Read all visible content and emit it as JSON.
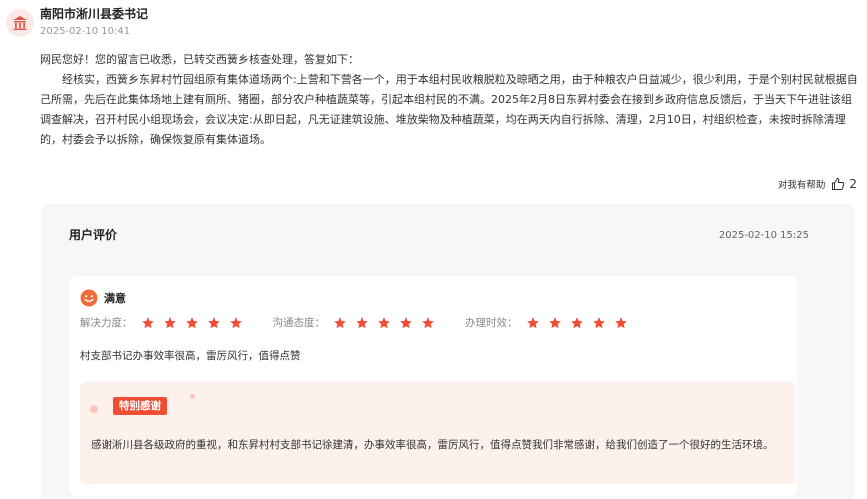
{
  "header": {
    "org_name": "南阳市淅川县委书记",
    "time": "2025-02-10 10:41",
    "avatar_icon": "building-icon"
  },
  "reply": {
    "greeting": "网民您好！您的留言已收悉，已转交西簧乡核查处理，答复如下：",
    "body": "经核实，西簧乡东昇村竹园组原有集体道场两个:上营和下营各一个，用于本组村民收粮脱粒及晾晒之用，由于种粮农户日益减少，很少利用，于是个别村民就根据自己所需，先后在此集体场地上建有厕所、猪圈，部分农户种植蔬菜等，引起本组村民的不满。2025年2月8日东昇村委会在接到乡政府信息反馈后，于当天下午进驻该组调查解决，召开村民小组现场会，会议决定:从即日起，凡无证建筑设施、堆放柴物及种植蔬菜，均在两天内自行拆除、清理，2月10日，村组织检查，未按时拆除清理的，村委会予以拆除，确保恢复原有集体道场。"
  },
  "helpful": {
    "label": "对我有帮助",
    "count": "2",
    "icon": "thumbs-up-icon"
  },
  "review": {
    "title": "用户评价",
    "time": "2025-02-10 15:25",
    "satisfaction": "满意",
    "satisfaction_icon": "smiley-face-icon",
    "ratings": [
      {
        "label": "解决力度：",
        "stars": 5
      },
      {
        "label": "沟通态度：",
        "stars": 5
      },
      {
        "label": "办理时效：",
        "stars": 5
      }
    ],
    "comment": "村支部书记办事效率很高，雷厉风行，值得点赞",
    "thanks_tag": "特别感谢",
    "thanks_text": "感谢淅川县各级政府的重视，和东昇村村支部书记徐建清，办事效率很高，雷厉风行，值得点赞我们非常感谢，给我们创造了一个很好的生活环境。"
  },
  "colors": {
    "accent": "#f04d35",
    "star": "#f04d35",
    "thanks_bg": "#fdf1ec",
    "panel_bg": "#f6f7f9"
  }
}
